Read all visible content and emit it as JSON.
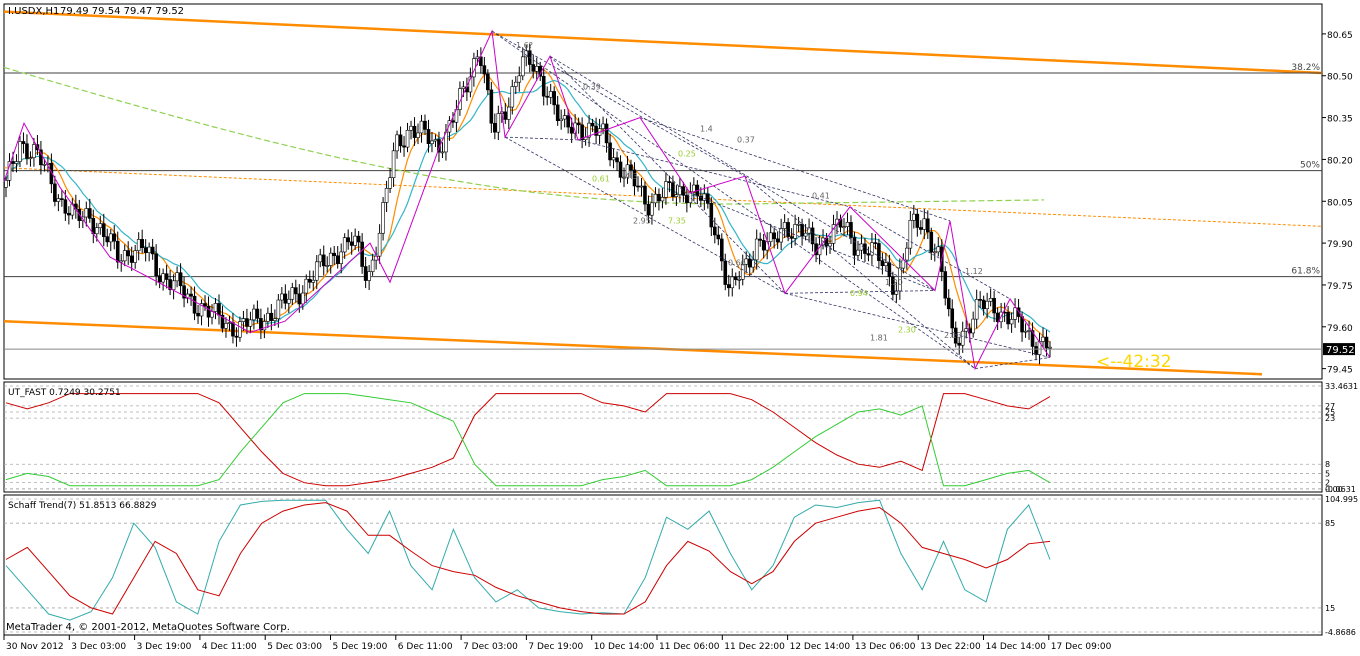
{
  "header": {
    "symbol": "I.USDX,H1",
    "ohlc": "79.49 79.54 79.47 79.52"
  },
  "colors": {
    "background": "#ffffff",
    "frame": "#000000",
    "grid": "#c8c8c8",
    "text": "#000000",
    "channel": "#ff8c00",
    "fib_level": "#404040",
    "orange_ma": "#ff8c00",
    "aqua_ma": "#33b5c8",
    "green_ma": "#8fd14f",
    "zigzag": "#cc00cc",
    "harmonic": "#333366",
    "ratio_text": "#666666",
    "ratio_text_alt": "#9acd32",
    "candle": "#000000",
    "countdown": "#ffd700",
    "ut_red": "#cc0000",
    "ut_green": "#33cc33",
    "schaff_cyan": "#33aaaa",
    "schaff_red": "#cc0000"
  },
  "countdown": "<--42:32",
  "price_tag": "79.52",
  "footer": "MetaTrader 4, © 2001-2012, MetaQuotes Software Corp.",
  "chart_data": [
    {
      "type": "candlestick",
      "title": "I.USDX,H1",
      "ylim": [
        79.42,
        80.75
      ],
      "y_ticks": [
        80.65,
        80.5,
        80.35,
        80.2,
        80.05,
        79.9,
        79.75,
        79.6,
        79.45
      ],
      "y_tick_labels": [
        "80.65",
        "80.50",
        "80.35",
        "80.20",
        "80.05",
        "79.90",
        "79.75",
        "79.60",
        "79.45"
      ],
      "current_price": 79.52,
      "fib_levels": [
        {
          "label": "38.2%",
          "value": 80.51
        },
        {
          "label": "50%",
          "value": 80.16
        },
        {
          "label": "61.8%",
          "value": 79.78
        }
      ],
      "x_tick_labels": [
        "30 Nov 2012",
        "3 Dec 03:00",
        "3 Dec 19:00",
        "4 Dec 11:00",
        "5 Dec 03:00",
        "5 Dec 19:00",
        "6 Dec 11:00",
        "7 Dec 03:00",
        "7 Dec 19:00",
        "10 Dec 14:00",
        "11 Dec 06:00",
        "11 Dec 22:00",
        "12 Dec 14:00",
        "13 Dec 06:00",
        "13 Dec 22:00",
        "14 Dec 14:00",
        "17 Dec 09:00"
      ],
      "close_path": [
        80.1,
        80.27,
        80.22,
        80.15,
        80.05,
        79.98,
        80.01,
        79.93,
        79.85,
        79.88,
        79.87,
        79.8,
        79.76,
        79.7,
        79.68,
        79.63,
        79.61,
        79.6,
        79.62,
        79.65,
        79.68,
        79.73,
        79.78,
        79.83,
        79.89,
        79.9,
        79.78,
        79.98,
        80.25,
        80.32,
        80.28,
        80.25,
        80.33,
        80.45,
        80.62,
        80.28,
        80.4,
        80.55,
        80.52,
        80.45,
        80.3,
        80.33,
        80.3,
        80.28,
        80.18,
        80.12,
        80.05,
        80.07,
        80.08,
        80.1,
        80.05,
        79.95,
        79.72,
        79.8,
        79.92,
        79.88,
        79.97,
        79.95,
        79.88,
        79.93,
        79.96,
        79.9,
        79.88,
        79.82,
        79.75,
        79.95,
        79.98,
        79.85,
        79.55,
        79.6,
        79.67,
        79.68,
        79.63,
        79.6,
        79.55,
        79.52
      ],
      "ratio_labels": [
        "1.6?",
        "0.39",
        "0.25",
        "0.37",
        "1.4",
        "0.61",
        "4.3",
        "2.95",
        "7.35",
        "0.66",
        "0.41",
        "0.94",
        "1.20",
        "1.81",
        "2.30",
        "2.13",
        "1.12"
      ]
    },
    {
      "type": "line",
      "title": "UT_FAST 0.7249 30.2751",
      "ylim": [
        -0.0631,
        33.4631
      ],
      "y_tick_labels": [
        "33.4631",
        "27",
        "25",
        "23",
        "8",
        "5",
        "2",
        "0.00",
        "-0.0631"
      ],
      "series": [
        {
          "name": "red",
          "values": [
            28,
            26,
            28,
            31,
            31,
            31,
            31,
            31,
            31,
            31,
            28,
            20,
            12,
            5,
            2,
            1,
            1,
            2,
            3,
            5,
            7,
            10,
            24,
            31,
            31,
            31,
            31,
            31,
            28,
            27,
            25,
            31,
            31,
            31,
            31,
            29,
            25,
            20,
            15,
            11,
            8,
            7,
            9,
            6,
            31,
            31,
            29,
            27,
            26,
            30
          ]
        },
        {
          "name": "green",
          "values": [
            3,
            5,
            4,
            1,
            1,
            1,
            1,
            1,
            1,
            1,
            3,
            12,
            20,
            28,
            31,
            31,
            31,
            30,
            29,
            28,
            25,
            22,
            8,
            1,
            1,
            1,
            1,
            1,
            3,
            4,
            6,
            1,
            1,
            1,
            1,
            3,
            7,
            12,
            17,
            21,
            25,
            26,
            24,
            27,
            1,
            1,
            3,
            5,
            6,
            2
          ]
        }
      ]
    },
    {
      "type": "line",
      "title": "Schaff Trend(7) 51.8513 66.8829",
      "ylim": [
        -4.8686,
        104.995
      ],
      "y_tick_labels": [
        "104.995",
        "85",
        "15",
        "-4.8686"
      ],
      "series": [
        {
          "name": "cyan",
          "values": [
            50,
            30,
            10,
            5,
            12,
            40,
            85,
            65,
            20,
            10,
            70,
            100,
            103,
            104,
            104,
            104,
            80,
            60,
            95,
            50,
            30,
            80,
            40,
            20,
            30,
            15,
            12,
            10,
            11,
            10,
            40,
            90,
            80,
            95,
            60,
            30,
            50,
            90,
            100,
            98,
            102,
            104,
            60,
            30,
            70,
            30,
            20,
            80,
            100,
            55
          ]
        },
        {
          "name": "red",
          "values": [
            55,
            65,
            45,
            25,
            15,
            10,
            40,
            70,
            60,
            30,
            25,
            60,
            85,
            95,
            100,
            102,
            95,
            75,
            75,
            62,
            50,
            45,
            42,
            32,
            25,
            20,
            15,
            12,
            10,
            10,
            20,
            50,
            70,
            62,
            45,
            35,
            45,
            70,
            85,
            90,
            95,
            98,
            85,
            65,
            60,
            55,
            48,
            55,
            68,
            70
          ]
        }
      ]
    }
  ]
}
